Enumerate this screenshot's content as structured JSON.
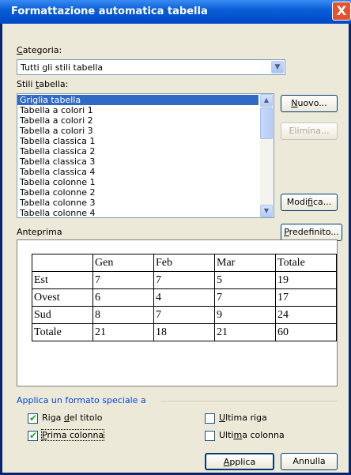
{
  "window": {
    "title": "Formattazione automatica tabella",
    "close_glyph": "X"
  },
  "categoria": {
    "label_accel": "C",
    "label_rest": "ategoria:",
    "value": "Tutti gli stili tabella"
  },
  "stili": {
    "label_pre": "Stili ",
    "label_accel": "t",
    "label_rest": "abella:",
    "items": [
      "Griglia tabella",
      "Tabella a colori 1",
      "Tabella a colori 2",
      "Tabella a colori 3",
      "Tabella classica 1",
      "Tabella classica 2",
      "Tabella classica 3",
      "Tabella classica 4",
      "Tabella colonne 1",
      "Tabella colonne 2",
      "Tabella colonne 3",
      "Tabella colonne 4"
    ]
  },
  "buttons": {
    "nuovo_accel": "N",
    "nuovo_rest": "uovo...",
    "elimina": "Elimina...",
    "modifica_pre": "Modi",
    "modifica_accel": "f",
    "modifica_rest": "ica...",
    "predefinito_accel": "P",
    "predefinito_rest": "redefinito...",
    "applica_accel": "A",
    "applica_rest": "pplica",
    "annulla": "Annulla"
  },
  "anteprima": {
    "label": "Anteprima",
    "rows": [
      [
        "",
        "Gen",
        "Feb",
        "Mar",
        "Totale"
      ],
      [
        "Est",
        "7",
        "7",
        "5",
        "19"
      ],
      [
        "Ovest",
        "6",
        "4",
        "7",
        "17"
      ],
      [
        "Sud",
        "8",
        "7",
        "9",
        "24"
      ],
      [
        "Totale",
        "21",
        "18",
        "21",
        "60"
      ]
    ]
  },
  "formato_speciale": {
    "title": "Applica un formato speciale a",
    "riga_titolo": {
      "pre": "Riga ",
      "accel": "d",
      "rest": "el titolo",
      "checked": true
    },
    "prima_colonna": {
      "pre": "",
      "accel": "P",
      "rest": "rima colonna",
      "checked": true
    },
    "ultima_riga": {
      "pre": "",
      "accel": "U",
      "rest": "ltima riga",
      "checked": false
    },
    "ultima_colonna": {
      "pre": "Ulti",
      "accel": "m",
      "rest": "a colonna",
      "checked": false
    }
  },
  "colors": {
    "selection": "#316ac5",
    "section_title": "#0046d5",
    "check": "#21a121"
  }
}
